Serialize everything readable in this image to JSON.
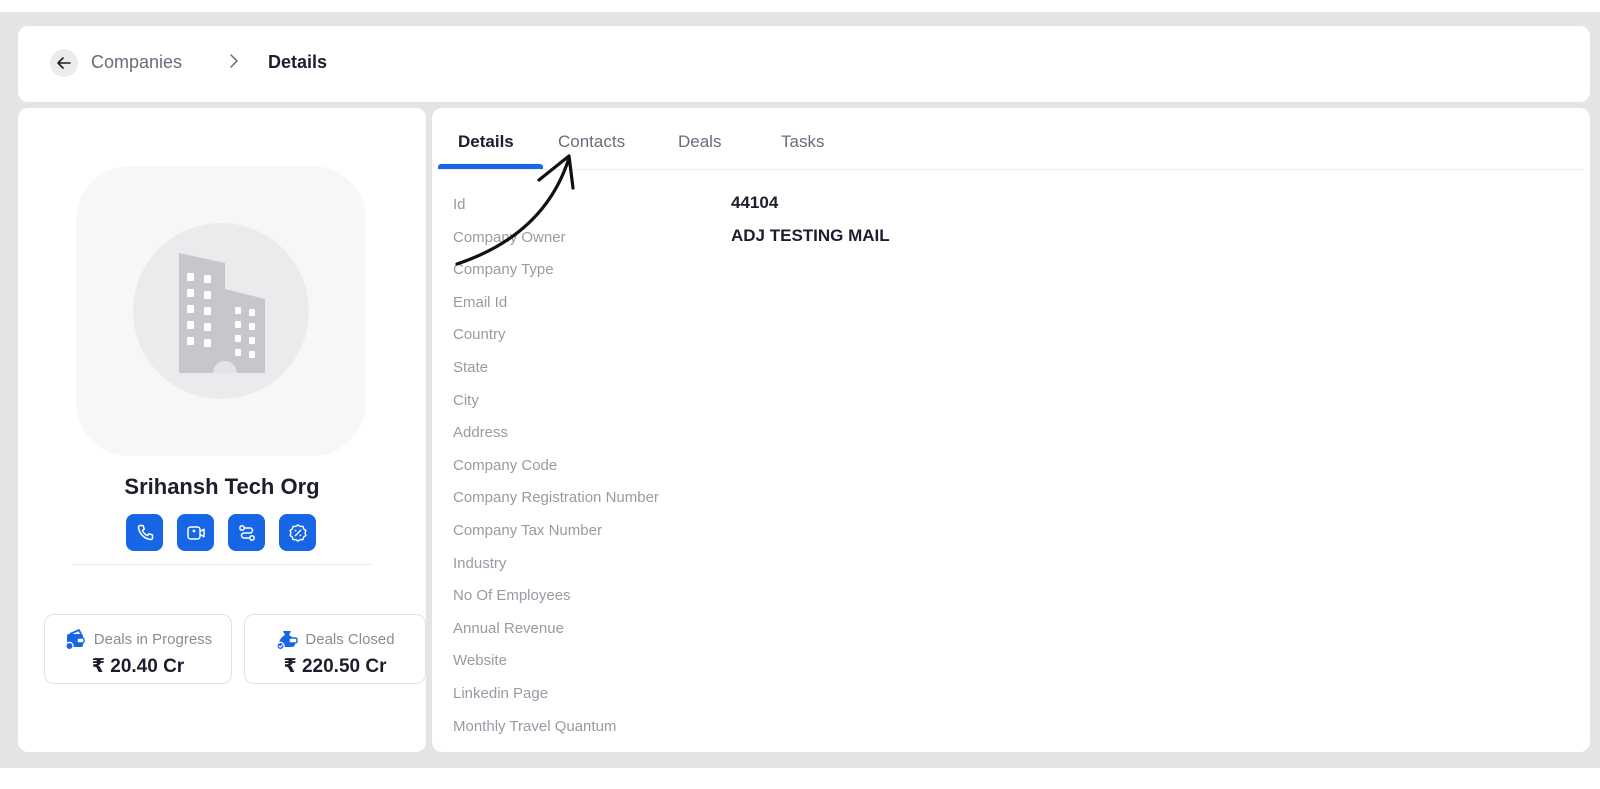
{
  "breadcrumb": {
    "back_icon": "arrow-left-icon",
    "parent": "Companies",
    "separator_icon": "chevron-right-icon",
    "current": "Details"
  },
  "company": {
    "name": "Srihansh Tech Org",
    "avatar_icon": "building-icon",
    "actions": [
      {
        "icon": "phone-icon"
      },
      {
        "icon": "video-call-icon"
      },
      {
        "icon": "route-icon"
      },
      {
        "icon": "discount-badge-icon"
      }
    ]
  },
  "stats": [
    {
      "label": "Deals in Progress",
      "value": "₹ 20.40 Cr",
      "icon": "wallet-icon"
    },
    {
      "label": "Deals Closed",
      "value": "₹ 220.50 Cr",
      "icon": "money-bag-icon"
    }
  ],
  "tabs": [
    {
      "label": "Details",
      "active": true
    },
    {
      "label": "Contacts",
      "active": false
    },
    {
      "label": "Deals",
      "active": false
    },
    {
      "label": "Tasks",
      "active": false
    }
  ],
  "fields": [
    {
      "label": "Id",
      "value": "44104"
    },
    {
      "label": "Company Owner",
      "value": "ADJ TESTING MAIL"
    },
    {
      "label": "Company Type",
      "value": ""
    },
    {
      "label": "Email Id",
      "value": ""
    },
    {
      "label": "Country",
      "value": ""
    },
    {
      "label": "State",
      "value": ""
    },
    {
      "label": "City",
      "value": ""
    },
    {
      "label": "Address",
      "value": ""
    },
    {
      "label": "Company Code",
      "value": ""
    },
    {
      "label": "Company Registration Number",
      "value": ""
    },
    {
      "label": "Company Tax Number",
      "value": ""
    },
    {
      "label": "Industry",
      "value": ""
    },
    {
      "label": "No Of Employees",
      "value": ""
    },
    {
      "label": "Annual Revenue",
      "value": ""
    },
    {
      "label": "Website",
      "value": ""
    },
    {
      "label": "Linkedin Page",
      "value": ""
    },
    {
      "label": "Monthly Travel Quantum",
      "value": ""
    }
  ],
  "colors": {
    "accent": "#1766e5",
    "text_dark": "#1d1d2f",
    "text_muted": "#9a9aa5",
    "background": "#e4e4e4"
  }
}
